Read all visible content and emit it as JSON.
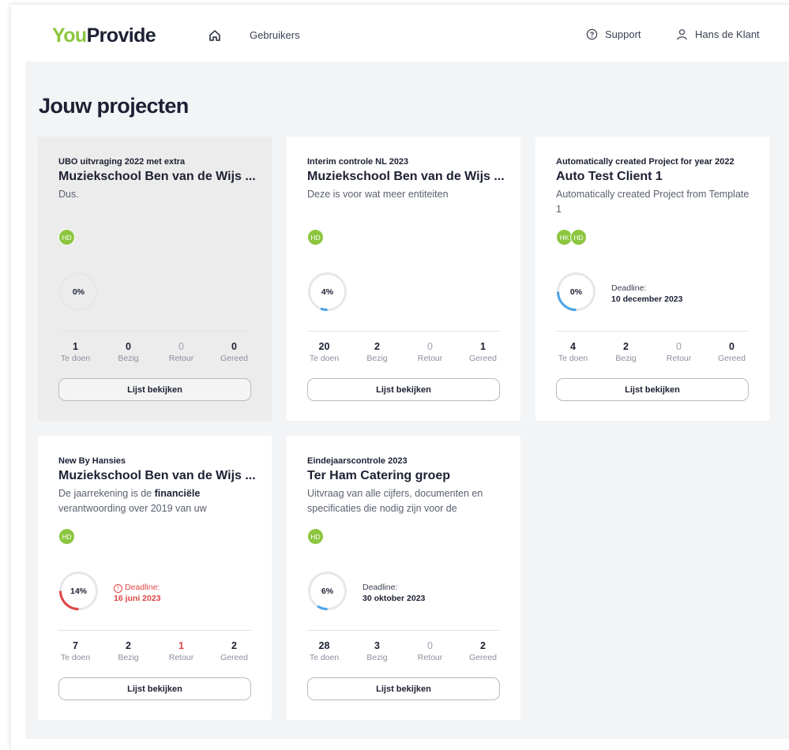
{
  "logo": {
    "part1": "You",
    "part2": "Pro",
    "part3": "vide"
  },
  "nav": {
    "users": "Gebruikers",
    "support": "Support",
    "user_name": "Hans de Klant"
  },
  "page": {
    "title": "Jouw projecten"
  },
  "colors": {
    "brand_green": "#8cc63f",
    "progress_blue": "#4aa3e8",
    "warning_red": "#e04545"
  },
  "stat_labels": {
    "todo": "Te doen",
    "busy": "Bezig",
    "returned": "Retour",
    "done": "Gereed"
  },
  "button_label": "Lijst bekijken",
  "projects": [
    {
      "subtitle": "UBO uitvraging 2022 met extra",
      "title": "Muziekschool Ben van de Wijs ...",
      "description": "Dus.",
      "avatars": [
        "HD"
      ],
      "progress": "0%",
      "progress_value": 0,
      "deadline": null,
      "stats": {
        "todo": "1",
        "busy": "0",
        "returned": "0",
        "done": "0"
      }
    },
    {
      "subtitle": "Interim controle NL 2023",
      "title": "Muziekschool Ben van de Wijs ...",
      "description": "Deze is voor wat meer entiteiten",
      "avatars": [
        "HD"
      ],
      "progress": "4%",
      "progress_value": 0.04,
      "deadline": null,
      "stats": {
        "todo": "20",
        "busy": "2",
        "returned": "0",
        "done": "1"
      }
    },
    {
      "subtitle": "Automatically created Project for year 2022",
      "title": "Auto Test Client 1",
      "description": "Automatically created Project from Template 1",
      "avatars": [
        "HK",
        "HD"
      ],
      "progress": "0%",
      "progress_value": 0,
      "deadline": {
        "label": "Deadline:",
        "date": "10 december 2023",
        "overdue": false
      },
      "stats": {
        "todo": "4",
        "busy": "2",
        "returned": "0",
        "done": "0"
      }
    },
    {
      "subtitle": "New By Hansies",
      "title": "Muziekschool Ben van de Wijs ...",
      "description_pre": "De jaarrekening is de ",
      "description_bold": "financiële",
      "description_post": " verantwoording over 2019 van uw",
      "avatars": [
        "HD"
      ],
      "progress": "14%",
      "progress_value": 0.14,
      "deadline": {
        "label": "Deadline:",
        "date": "16 juni 2023",
        "overdue": true
      },
      "stats": {
        "todo": "7",
        "busy": "2",
        "returned": "1",
        "done": "2"
      }
    },
    {
      "subtitle": "Eindejaarscontrole 2023",
      "title": "Ter Ham Catering groep",
      "description": "Uitvraag van alle cijfers, documenten en specificaties die nodig zijn voor de",
      "avatars": [
        "HD"
      ],
      "progress": "6%",
      "progress_value": 0.06,
      "deadline": {
        "label": "Deadline:",
        "date": "30 oktober 2023",
        "overdue": false
      },
      "stats": {
        "todo": "28",
        "busy": "3",
        "returned": "0",
        "done": "2"
      }
    }
  ]
}
